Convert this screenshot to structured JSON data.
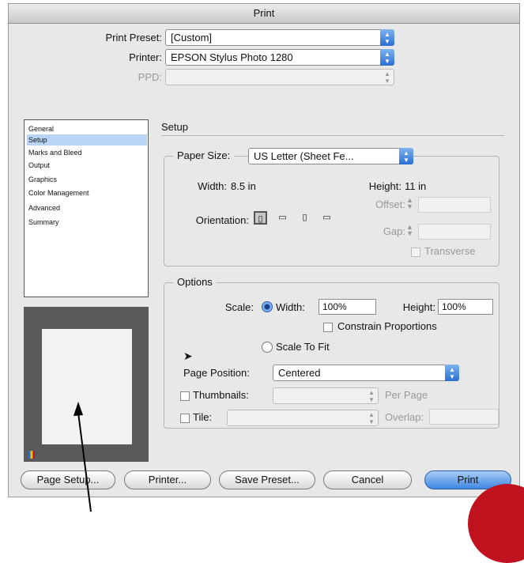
{
  "dialog": {
    "title": "Print"
  },
  "header": {
    "preset_label": "Print Preset:",
    "preset_value": "[Custom]",
    "printer_label": "Printer:",
    "printer_value": "EPSON Stylus Photo 1280",
    "ppd_label": "PPD:",
    "ppd_value": ""
  },
  "sidebar": {
    "items": [
      {
        "label": "General"
      },
      {
        "label": "Setup",
        "selected": true
      },
      {
        "label": "Marks and Bleed"
      },
      {
        "label": "Output"
      },
      {
        "label": "Graphics"
      },
      {
        "label": "Color Management"
      },
      {
        "label": "Advanced"
      },
      {
        "label": "Summary"
      }
    ]
  },
  "setup": {
    "section_title": "Setup",
    "paper_size_label": "Paper Size:",
    "paper_size_value": "US Letter (Sheet Fe...",
    "width_label": "Width:",
    "width_value": "8.5 in",
    "height_label": "Height:",
    "height_value": "11 in",
    "orientation_label": "Orientation:",
    "orientation_icons": [
      "portrait-icon",
      "landscape-icon",
      "reverse-portrait-icon",
      "reverse-landscape-icon"
    ],
    "offset_label": "Offset:",
    "gap_label": "Gap:",
    "transverse_label": "Transverse"
  },
  "options": {
    "section_title": "Options",
    "scale_label": "Scale:",
    "width_radio_label": "Width:",
    "width_value": "100%",
    "height_label": "Height:",
    "height_value": "100%",
    "constrain_label": "Constrain Proportions",
    "scale_to_fit_label": "Scale To Fit",
    "page_position_label": "Page Position:",
    "page_position_value": "Centered",
    "thumbnails_label": "Thumbnails:",
    "per_page_label": "Per Page",
    "tile_label": "Tile:",
    "overlap_label": "Overlap:"
  },
  "buttons": {
    "page_setup": "Page Setup...",
    "printer": "Printer...",
    "save_preset": "Save Preset...",
    "cancel": "Cancel",
    "print": "Print"
  },
  "colors": {
    "accent_blue": "#3f86e0",
    "selection_blue": "#b9d4f5",
    "preview_bg": "#5a5a5a",
    "corner_circle": "#c1121f"
  }
}
